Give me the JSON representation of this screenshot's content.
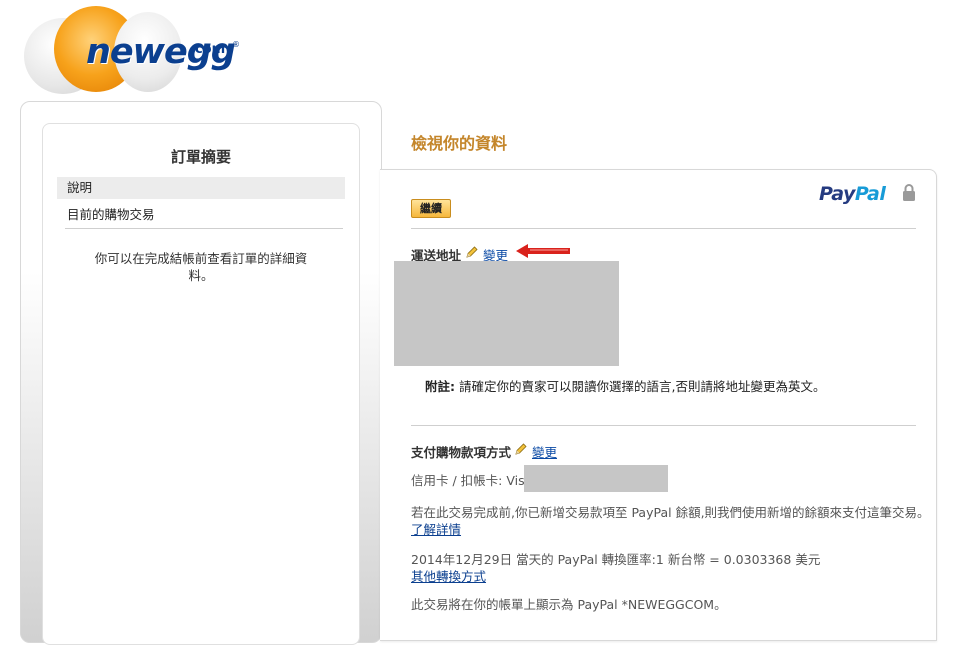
{
  "logo": {
    "word": "newegg",
    "suffix": "·com",
    "registered": "®"
  },
  "summary": {
    "title": "訂單摘要",
    "nav": [
      {
        "label": "說明"
      },
      {
        "label": "目前的購物交易"
      }
    ],
    "description": "你可以在完成結帳前查看訂單的詳細資料。"
  },
  "review": {
    "title": "檢視你的資料",
    "paypal_pay": "Pay",
    "paypal_pal": "Pal",
    "continue_label": "繼續",
    "shipping_label": "運送地址",
    "shipping_change": "變更",
    "note_bold": "附註:",
    "note_text": " 請確定你的賣家可以閱讀你選擇的語言,否則請將地址變更為英文。",
    "payment_label": "支付購物款項方式",
    "payment_change": "變更",
    "card_label": "信用卡 / 扣帳卡: Visa",
    "balance_text": "若在此交易完成前,你已新增交易款項至 PayPal 餘額,則我們使用新增的餘額來支付這筆交易。",
    "learn_more": "了解詳情",
    "rate_text": "2014年12月29日 當天的 PayPal 轉換匯率:1 新台幣 = 0.0303368 美元",
    "other_conversion": "其他轉換方式",
    "statement_text": "此交易將在你的帳單上顯示為 PayPal *NEWEGGCOM。"
  },
  "colors": {
    "title_gold": "#c4862b",
    "link_blue": "#0b3f8f",
    "paypal_dark": "#253b80",
    "paypal_light": "#179bd7",
    "arrow_red": "#d9221c"
  }
}
